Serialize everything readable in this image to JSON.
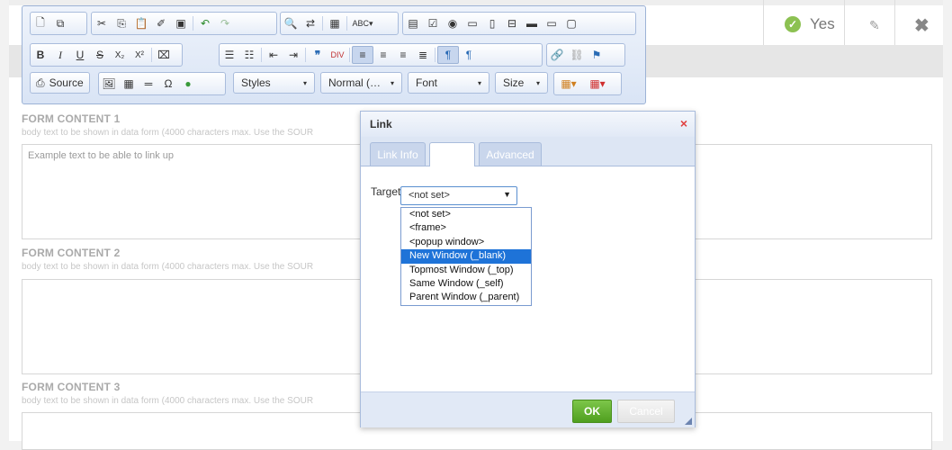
{
  "table_row": {
    "status_label": "Yes",
    "colors": {
      "check": "#8cc152"
    }
  },
  "toolbar": {
    "source_label": "Source",
    "styles_label": "Styles",
    "format_label": "Normal (…",
    "font_label": "Font",
    "size_label": "Size",
    "bold_label": "B",
    "italic_label": "I",
    "underline_label": "U",
    "strike_label": "S",
    "subscript_label": "X₂",
    "superscript_label": "X²",
    "omega_label": "Ω"
  },
  "sections": [
    {
      "title": "FORM CONTENT 1",
      "help": "body text to be shown in data form (4000 characters max. Use the SOUR",
      "value": "Example text to be able to link up"
    },
    {
      "title": "FORM CONTENT 2",
      "help": "body text to be shown in data form (4000 characters max. Use the SOUR",
      "value": ""
    },
    {
      "title": "FORM CONTENT 3",
      "help": "body text to be shown in data form (4000 characters max. Use the SOUR",
      "value": ""
    }
  ],
  "dialog": {
    "title": "Link",
    "close_icon": "×",
    "tabs": [
      {
        "label": "Link Info"
      },
      {
        "label": ""
      },
      {
        "label": "Advanced"
      }
    ],
    "target_label": "Target",
    "selected_value": "<not set>",
    "options": [
      "<not set>",
      "<frame>",
      "<popup window>",
      "New Window (_blank)",
      "Topmost Window (_top)",
      "Same Window (_self)",
      "Parent Window (_parent)"
    ],
    "highlighted_option": "New Window (_blank)",
    "ok_label": "OK",
    "cancel_label": "Cancel"
  }
}
